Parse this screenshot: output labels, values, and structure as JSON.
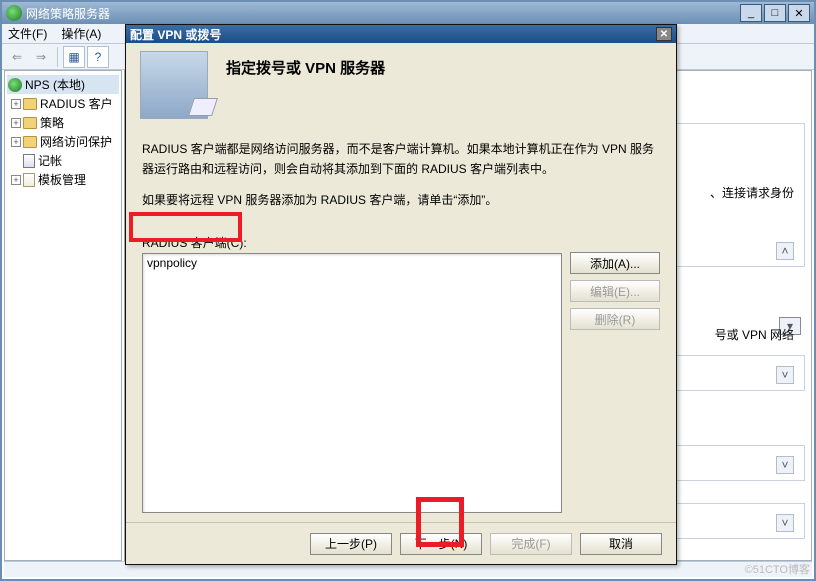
{
  "mmc": {
    "title": "网络策略服务器",
    "menu": {
      "file": "文件(F)",
      "action": "操作(A)"
    },
    "tree_root": "NPS (本地)",
    "tree": {
      "radius_clients": "RADIUS 客户",
      "policies": "策略",
      "network_access": "网络访问保护",
      "accounting": "记帐",
      "templates": "模板管理"
    },
    "panel": {
      "right_text_line1": "、连接请求身份",
      "right_text_line2": "号或 VPN 网络"
    }
  },
  "dialog": {
    "title": "配置 VPN 或拨号",
    "heading": "指定拨号或 VPN 服务器",
    "body1": "RADIUS 客户端都是网络访问服务器，而不是客户端计算机。如果本地计算机正在作为 VPN 服务器运行路由和远程访问，则会自动将其添加到下面的 RADIUS 客户端列表中。",
    "body2": "如果要将远程 VPN 服务器添加为 RADIUS 客户端，请单击“添加”。",
    "client_label": "RADIUS 客户端(C):",
    "client_item": "vpnpolicy",
    "buttons": {
      "add": "添加(A)...",
      "edit": "编辑(E)...",
      "remove": "删除(R)"
    },
    "footer": {
      "back": "上一步(P)",
      "next": "下一步(N)",
      "finish": "完成(F)",
      "cancel": "取消"
    }
  },
  "watermark": "©51CTO博客"
}
